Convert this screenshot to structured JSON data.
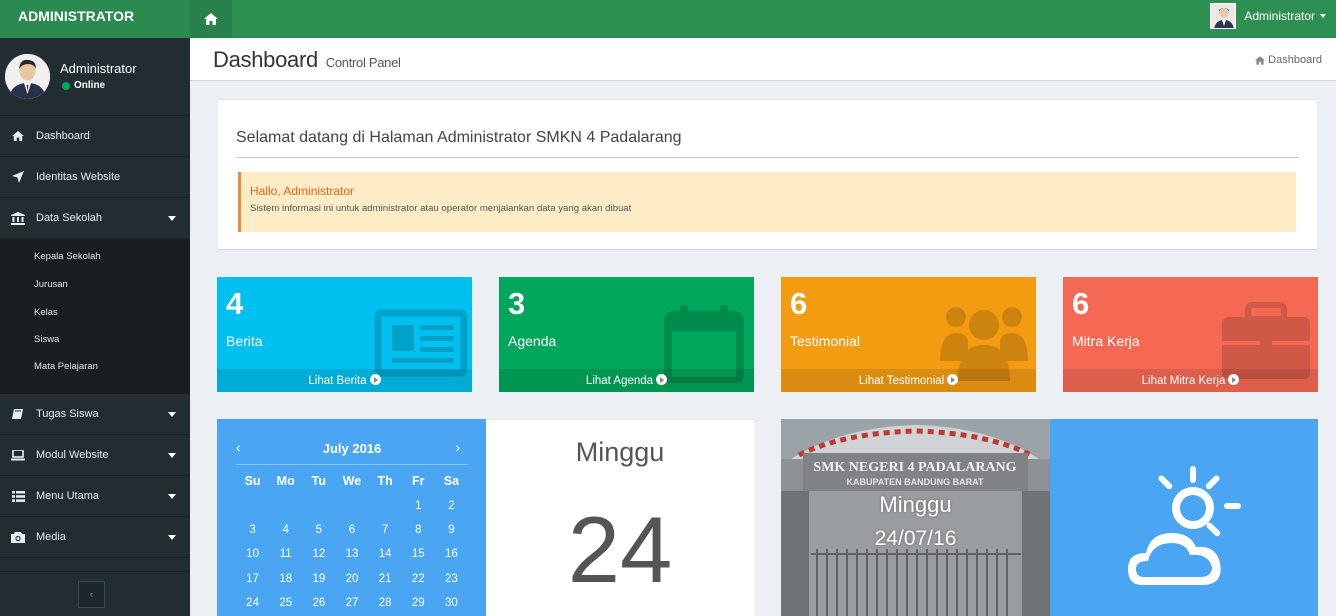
{
  "brand": "ADMINISTRATOR",
  "topbar": {
    "user_label": "Administrator"
  },
  "sidebar": {
    "user": {
      "name": "Administrator",
      "status": "Online"
    },
    "items": [
      {
        "label": "Dashboard",
        "icon": "home-icon"
      },
      {
        "label": "Identitas Website",
        "icon": "location-arrow-icon"
      },
      {
        "label": "Data Sekolah",
        "icon": "bank-icon",
        "expanded": true,
        "children": [
          "Kepala Sekolah",
          "Jurusan",
          "Kelas",
          "Siswa",
          "Mata Pelajaran"
        ]
      },
      {
        "label": "Tugas Siswa",
        "icon": "book-icon"
      },
      {
        "label": "Modul Website",
        "icon": "laptop-icon"
      },
      {
        "label": "Menu Utama",
        "icon": "list-icon"
      },
      {
        "label": "Media",
        "icon": "camera-icon"
      }
    ],
    "collapse_label": "‹"
  },
  "header": {
    "title": "Dashboard",
    "subtitle": "Control Panel",
    "breadcrumb": "Dashboard"
  },
  "welcome": {
    "title": "Selamat datang di Halaman Administrator SMKN 4 Padalarang",
    "callout_title": "Hallo, Administrator",
    "callout_text": "Sistem informasi ini untuk administrator atau operator menjalankan data yang akan dibuat"
  },
  "stats": [
    {
      "count": "4",
      "label": "Berita",
      "link": "Lihat Berita",
      "color": "#00c0ef",
      "icon": "newspaper-icon"
    },
    {
      "count": "3",
      "label": "Agenda",
      "link": "Lihat Agenda",
      "color": "#00a65a",
      "icon": "calendar-icon"
    },
    {
      "count": "6",
      "label": "Testimonial",
      "link": "Lihat Testimonial",
      "color": "#f39c12",
      "icon": "users-icon"
    },
    {
      "count": "6",
      "label": "Mitra Kerja",
      "link": "Lihat Mitra Kerja",
      "color": "#f56954",
      "icon": "briefcase-icon"
    }
  ],
  "calendar": {
    "month": "July 2016",
    "prev": "‹",
    "next": "›",
    "dow": [
      "Su",
      "Mo",
      "Tu",
      "We",
      "Th",
      "Fr",
      "Sa"
    ],
    "weeks": [
      [
        "",
        "",
        "",
        "",
        "",
        "1",
        "2"
      ],
      [
        "3",
        "4",
        "5",
        "6",
        "7",
        "8",
        "9"
      ],
      [
        "10",
        "11",
        "12",
        "13",
        "14",
        "15",
        "16"
      ],
      [
        "17",
        "18",
        "19",
        "20",
        "21",
        "22",
        "23"
      ],
      [
        "24",
        "25",
        "26",
        "27",
        "28",
        "29",
        "30"
      ]
    ]
  },
  "today": {
    "day_name": "Minggu",
    "day_number": "24"
  },
  "photo": {
    "sign_line1": "SMK NEGERI 4 PADALARANG",
    "sign_line2": "KABUPATEN BANDUNG BARAT",
    "day": "Minggu",
    "date": "24/07/16"
  },
  "weather": {
    "icon": "partly-cloudy-icon"
  }
}
